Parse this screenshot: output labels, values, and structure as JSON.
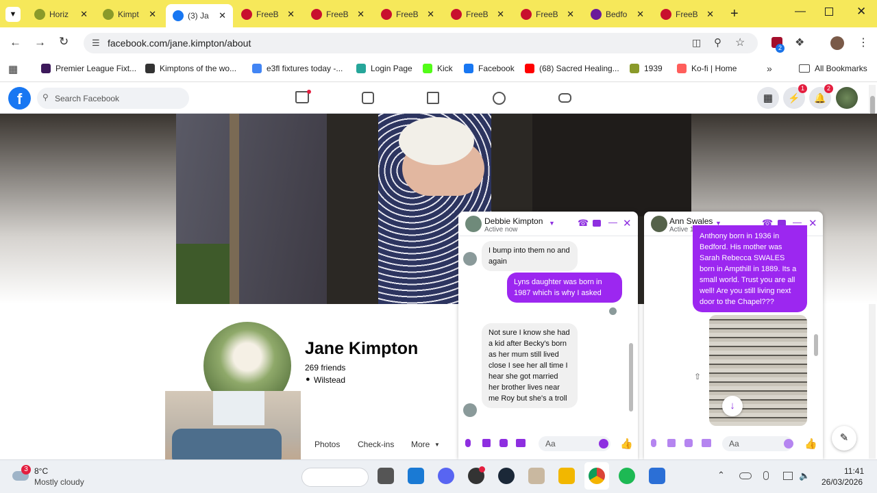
{
  "browser": {
    "tabs": [
      {
        "title": "Horiz",
        "icon": "horizon-icon",
        "color": "#8a9a2a"
      },
      {
        "title": "Kimpt",
        "icon": "kimpton-icon",
        "color": "#8a9a2a"
      },
      {
        "title": "(3) Ja",
        "icon": "facebook-icon",
        "color": "#1877f2",
        "active": true
      },
      {
        "title": "FreeB",
        "icon": "freebmd-icon",
        "color": "#c8102e"
      },
      {
        "title": "FreeB",
        "icon": "freebmd-icon",
        "color": "#c8102e"
      },
      {
        "title": "FreeB",
        "icon": "freebmd-icon",
        "color": "#c8102e"
      },
      {
        "title": "FreeB",
        "icon": "freebmd-icon",
        "color": "#c8102e"
      },
      {
        "title": "FreeB",
        "icon": "freebmd-icon",
        "color": "#c8102e"
      },
      {
        "title": "Bedfo",
        "icon": "bedford-icon",
        "color": "#6a1b9a"
      },
      {
        "title": "FreeB",
        "icon": "freebmd-icon",
        "color": "#c8102e"
      }
    ],
    "url": "facebook.com/jane.kimpton/about",
    "extension_badge": "2",
    "bookmarks": [
      {
        "label": "Premier League Fixt...",
        "icon": "premier-league-icon",
        "color": "#3d195b"
      },
      {
        "label": "Kimptons of the wo...",
        "icon": "globe-icon",
        "color": "#333333"
      },
      {
        "label": "e3fl fixtures today -...",
        "icon": "google-icon",
        "color": "#4285f4"
      },
      {
        "label": "Login Page",
        "icon": "login-icon",
        "color": "#26a69a"
      },
      {
        "label": "Kick",
        "icon": "kick-icon",
        "color": "#53fc18"
      },
      {
        "label": "Facebook",
        "icon": "facebook-icon",
        "color": "#1877f2"
      },
      {
        "label": "(68) Sacred Healing...",
        "icon": "youtube-icon",
        "color": "#ff0000"
      },
      {
        "label": "1939",
        "icon": "findmypast-icon",
        "color": "#8a9a2a"
      },
      {
        "label": "Ko-fi | Home",
        "icon": "kofi-icon",
        "color": "#ff5e5b"
      }
    ],
    "all_bookmarks": "All Bookmarks"
  },
  "facebook": {
    "search_placeholder": "Search Facebook",
    "messenger_badge": "1",
    "notif_badge": "2",
    "profile": {
      "name": "Jane Kimpton",
      "friends": "269 friends",
      "location": "Wilstead"
    },
    "profile_tabs": [
      "Photos",
      "Check-ins",
      "More"
    ]
  },
  "chat1": {
    "name": "Debbie Kimpton",
    "status": "Active now",
    "messages": [
      {
        "dir": "in",
        "text": "I bump into them no and again"
      },
      {
        "dir": "out",
        "text": "Lyns daughter was born in 1987 which is why I asked"
      },
      {
        "dir": "in",
        "text": "Not sure I know she had a kid after Becky's born as her mum still lived close I see her all time I hear she got married her brother lives near me Roy but she's a troll"
      }
    ],
    "composer": "Aa"
  },
  "chat2": {
    "name": "Ann Swales",
    "status": "Active 1h ago",
    "messages": [
      {
        "dir": "out",
        "text": "Anthony born in 1936 in Bedford. His mother was Sarah Rebecca SWALES born in Ampthill in 1889. Its a small world. Trust you are all well! Are you still living next door to the Chapel???"
      }
    ],
    "composer": "Aa"
  },
  "taskbar": {
    "weather_badge": "3",
    "temp": "8°C",
    "weather": "Mostly cloudy",
    "time": "11:41",
    "date": "26/03/2026"
  }
}
